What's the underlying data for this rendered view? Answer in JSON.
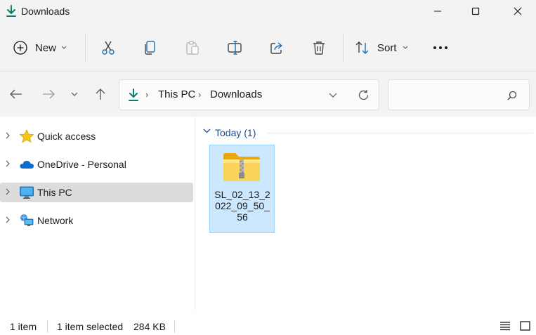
{
  "window": {
    "title": "Downloads"
  },
  "toolbar": {
    "new_label": "New",
    "sort_label": "Sort",
    "buttons": [
      "cut-icon",
      "copy-icon",
      "paste-icon",
      "rename-icon",
      "share-icon",
      "delete-icon",
      "more-icon"
    ]
  },
  "address": {
    "crumbs": [
      "This PC",
      "Downloads"
    ],
    "search_placeholder": ""
  },
  "sidebar": {
    "items": [
      {
        "label": "Quick access",
        "icon": "star-icon"
      },
      {
        "label": "OneDrive - Personal",
        "icon": "cloud-icon"
      },
      {
        "label": "This PC",
        "icon": "computer-icon",
        "selected": true
      },
      {
        "label": "Network",
        "icon": "network-icon"
      }
    ]
  },
  "content": {
    "group_label": "Today (1)",
    "files": [
      {
        "name": "SL_02_13_2022_09_50_56",
        "icon": "zip-folder-icon",
        "selected": true
      }
    ]
  },
  "status": {
    "item_count": "1 item",
    "selection": "1 item selected",
    "size": "284 KB"
  },
  "colors": {
    "accent": "#0f7b6c",
    "selection_bg": "#cce8ff",
    "selection_border": "#99d1ff",
    "chrome_bg": "#f3f3f3",
    "group_text": "#1f4e8c"
  }
}
